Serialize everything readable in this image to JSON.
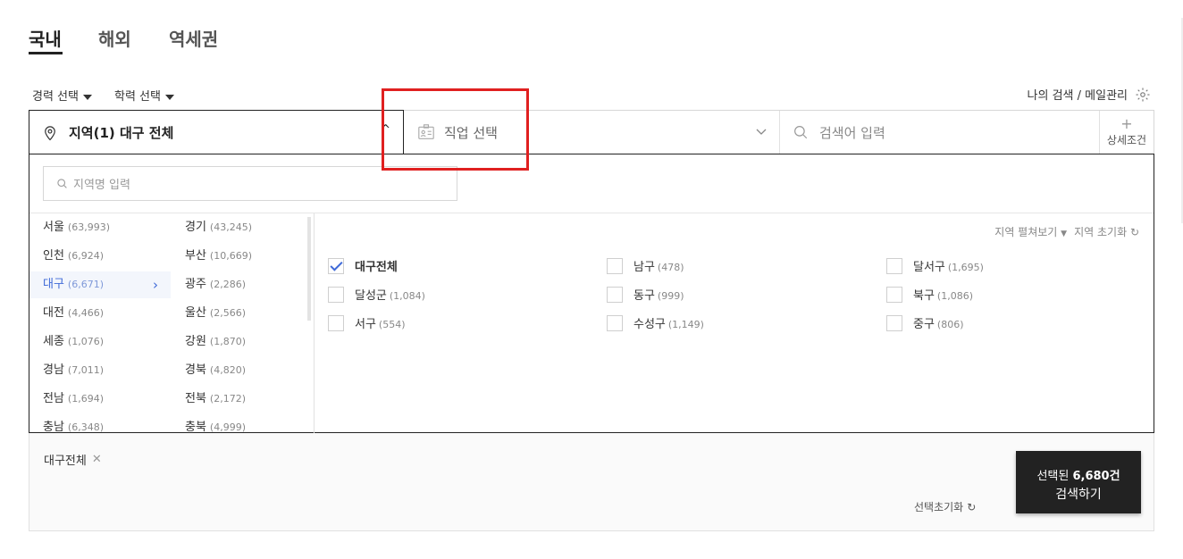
{
  "tabs": [
    "국내",
    "해외",
    "역세권"
  ],
  "filters": {
    "career": "경력 선택",
    "education": "학력 선택"
  },
  "my_search": "나의 검색 / 메일관리",
  "bar": {
    "region": "지역(1) 대구 전체",
    "job": "직업 선택",
    "keyword_placeholder": "검색어 입력",
    "advanced": "상세조건"
  },
  "region_search_placeholder": "지역명 입력",
  "regions_left": [
    {
      "name": "서울",
      "count": "(63,993)"
    },
    {
      "name": "인천",
      "count": "(6,924)"
    },
    {
      "name": "대구",
      "count": "(6,671)"
    },
    {
      "name": "대전",
      "count": "(4,466)"
    },
    {
      "name": "세종",
      "count": "(1,076)"
    },
    {
      "name": "경남",
      "count": "(7,011)"
    },
    {
      "name": "전남",
      "count": "(1,694)"
    },
    {
      "name": "충남",
      "count": "(6,348)"
    }
  ],
  "regions_right": [
    {
      "name": "경기",
      "count": "(43,245)"
    },
    {
      "name": "부산",
      "count": "(10,669)"
    },
    {
      "name": "광주",
      "count": "(2,286)"
    },
    {
      "name": "울산",
      "count": "(2,566)"
    },
    {
      "name": "강원",
      "count": "(1,870)"
    },
    {
      "name": "경북",
      "count": "(4,820)"
    },
    {
      "name": "전북",
      "count": "(2,172)"
    },
    {
      "name": "충북",
      "count": "(4,999)"
    }
  ],
  "tools": {
    "expand": "지역 펼쳐보기",
    "reset": "지역 초기화"
  },
  "districts": [
    {
      "name": "대구전체",
      "count": "",
      "checked": true
    },
    {
      "name": "달성군",
      "count": "(1,084)",
      "checked": false
    },
    {
      "name": "서구",
      "count": "(554)",
      "checked": false
    },
    {
      "name": "남구",
      "count": "(478)",
      "checked": false
    },
    {
      "name": "동구",
      "count": "(999)",
      "checked": false
    },
    {
      "name": "수성구",
      "count": "(1,149)",
      "checked": false
    },
    {
      "name": "달서구",
      "count": "(1,695)",
      "checked": false
    },
    {
      "name": "북구",
      "count": "(1,086)",
      "checked": false
    },
    {
      "name": "중구",
      "count": "(806)",
      "checked": false
    }
  ],
  "selected_chip": "대구전체",
  "selection_reset": "선택초기화",
  "search_button": {
    "line1_prefix": "선택된",
    "count": "6,680건",
    "line2": "검색하기"
  }
}
